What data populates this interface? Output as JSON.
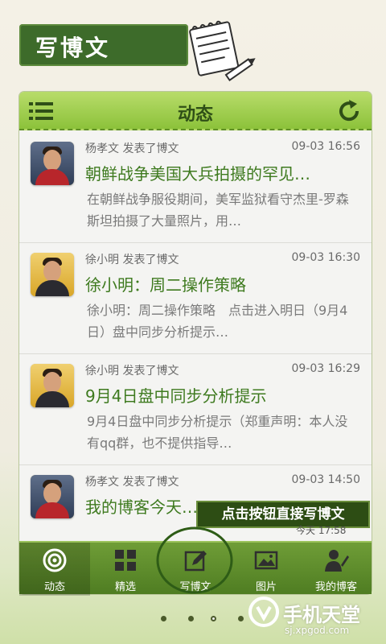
{
  "banner": {
    "label": "写博文"
  },
  "titlebar": {
    "title": "动态"
  },
  "feed": [
    {
      "user_action": "杨孝文 发表了博文",
      "time": "09-03 16:56",
      "title": "朝鲜战争美国大兵拍摄的罕见…",
      "excerpt": "在朝鲜战争服役期间，美军监狱看守杰里-罗森斯坦拍摄了大量照片，用…",
      "avatar": "person-red-scarf"
    },
    {
      "user_action": "徐小明 发表了博文",
      "time": "09-03 16:30",
      "title": "徐小明：周二操作策略",
      "excerpt": "徐小明：周二操作策略　点击进入明日（9月4日）盘中同步分析提示…",
      "avatar": "person-suit"
    },
    {
      "user_action": "徐小明 发表了博文",
      "time": "09-03 16:29",
      "title": "9月4日盘中同步分析提示",
      "excerpt": "9月4日盘中同步分析提示（郑重声明：本人没有qq群，也不提供指导…",
      "avatar": "person-suit"
    },
    {
      "user_action": "杨孝文 发表了博文",
      "time": "09-03 14:50",
      "title": "我的博客今天…",
      "excerpt": "",
      "avatar": "person-red-scarf"
    }
  ],
  "tooltip": {
    "text": "点击按钮直接写博文",
    "time": "今天 17:58"
  },
  "tabs": [
    {
      "label": "动态",
      "icon": "target-icon",
      "active": true
    },
    {
      "label": "精选",
      "icon": "grid-icon",
      "active": false
    },
    {
      "label": "写博文",
      "icon": "edit-icon",
      "active": false
    },
    {
      "label": "图片",
      "icon": "picture-icon",
      "active": false
    },
    {
      "label": "我的博客",
      "icon": "user-pen-icon",
      "active": false
    }
  ],
  "pager": {
    "count": 4,
    "active_index": 2
  },
  "watermark": {
    "title": "手机天堂",
    "url": "sj.xpgod.com"
  },
  "colors": {
    "brand_green": "#3d6b2a",
    "title_green": "#3e7a1f",
    "bar_green": "#8cc23a"
  }
}
